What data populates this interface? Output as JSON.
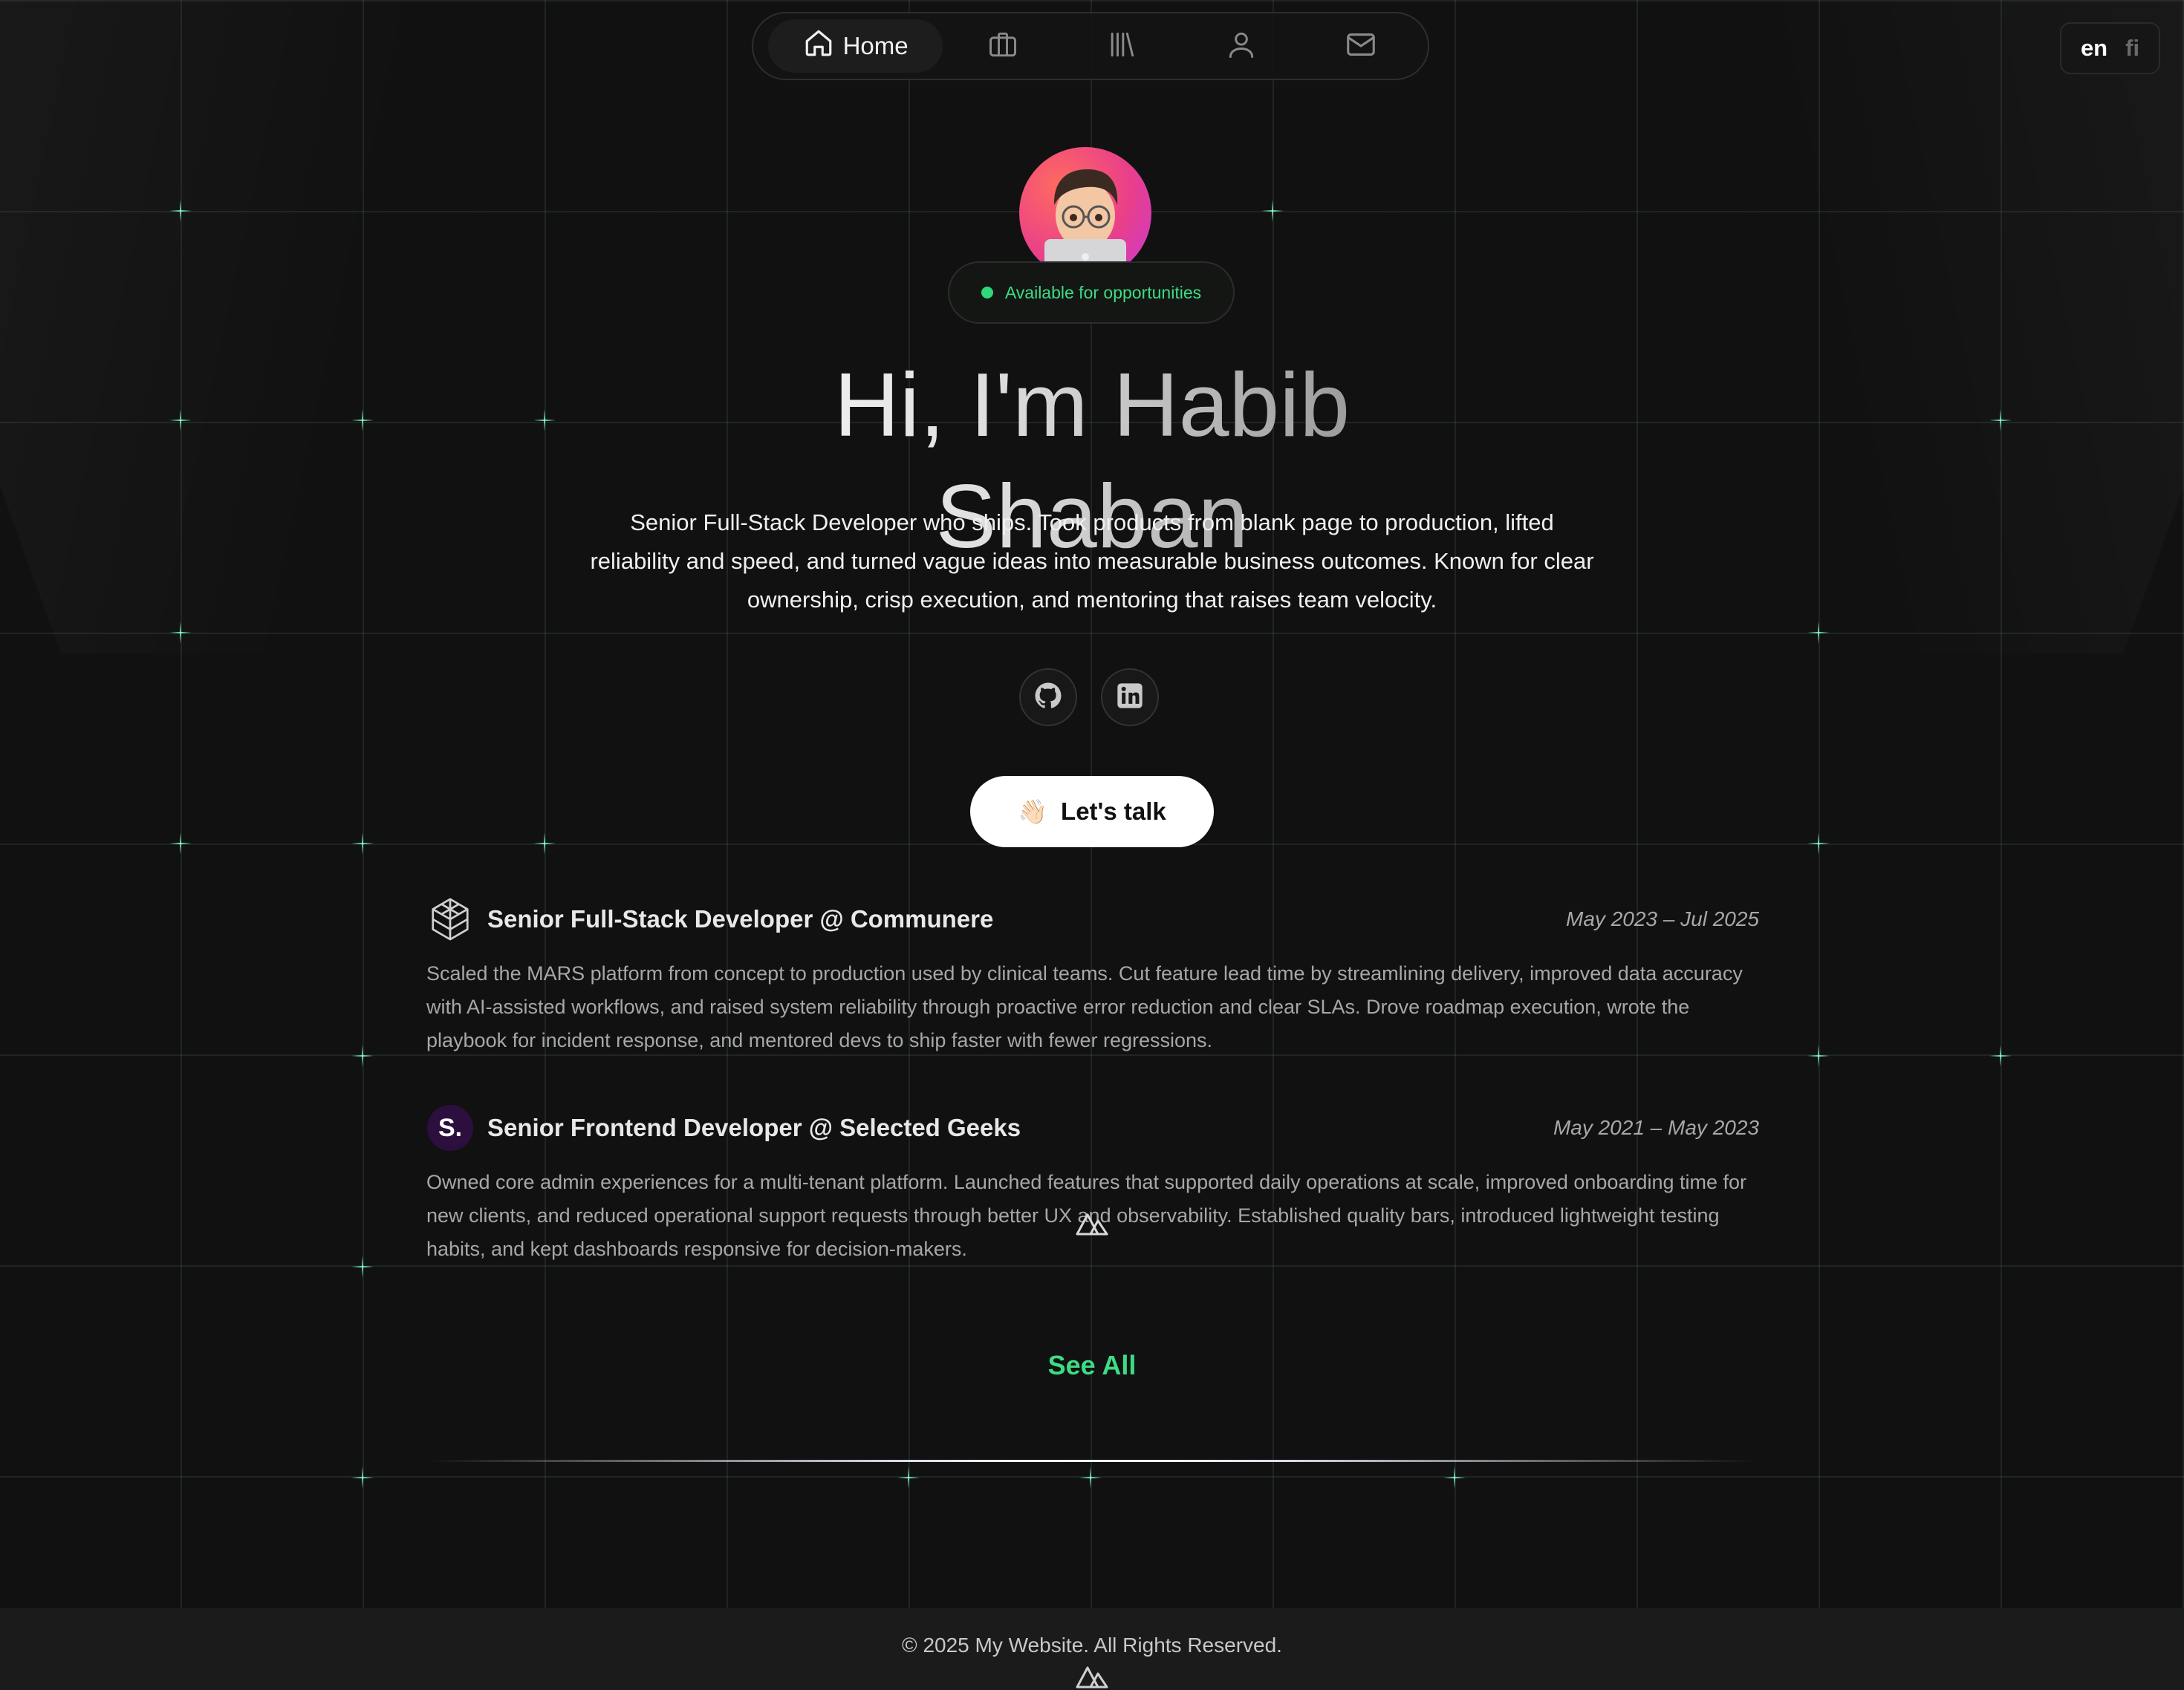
{
  "nav": {
    "home_label": "Home",
    "items": [
      {
        "icon": "briefcase-icon"
      },
      {
        "icon": "library-icon"
      },
      {
        "icon": "user-icon"
      },
      {
        "icon": "mail-icon"
      }
    ]
  },
  "lang": {
    "en": "en",
    "fi": "fi"
  },
  "hero": {
    "badge": "Available for opportunities",
    "headline": "Hi, I'm Habib Shaban",
    "intro": "Senior Full-Stack Developer who ships. Took products from blank page to production, lifted reliability and speed, and turned vague ideas into measurable business outcomes. Known for clear ownership, crisp execution, and mentoring that raises team velocity.",
    "cta_label": "Let's talk",
    "cta_emoji": "👋🏻"
  },
  "experience": [
    {
      "title": "Senior Full-Stack Developer @ Communere",
      "date": "May 2023 – Jul 2025",
      "description": "Scaled the MARS platform from concept to production used by clinical teams. Cut feature lead time by streamlining delivery, improved data accuracy with AI-assisted workflows, and raised system reliability through proactive error reduction and clear SLAs. Drove roadmap execution, wrote the playbook for incident response, and mentored devs to ship faster with fewer regressions."
    },
    {
      "title": "Senior Frontend Developer @ Selected Geeks",
      "date": "May 2021 – May 2023",
      "logo_text": "S.",
      "description": "Owned core admin experiences for a multi-tenant platform. Launched features that supported daily operations at scale, improved onboarding time for new clients, and reduced operational support requests through better UX and observability. Established quality bars, introduced lightweight testing habits, and kept dashboards responsive for decision-makers."
    }
  ],
  "see_all": "See All",
  "footer": "© 2025 My Website. All Rights Reserved.",
  "colors": {
    "accent": "#3ddc84",
    "background": "#111111"
  }
}
